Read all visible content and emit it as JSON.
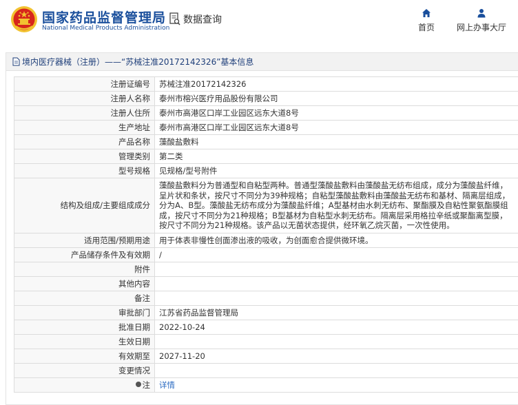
{
  "header": {
    "title_cn": "国家药品监督管理局",
    "title_en": "National Medical Products Administration",
    "query_label": "数据查询",
    "nav": [
      {
        "label": "首页",
        "icon": "home-icon"
      },
      {
        "label": "网上办事大厅",
        "icon": "user-icon"
      }
    ]
  },
  "colors": {
    "brand": "#1a4f9c",
    "emblem_red": "#d7261c",
    "emblem_gold": "#f2c230",
    "link": "#2b6bc2"
  },
  "breadcrumb": "境内医疗器械（注册）——“苏械注准20172142326”基本信息",
  "rows": [
    {
      "label": "注册证编号",
      "value": "苏械注准20172142326"
    },
    {
      "label": "注册人名称",
      "value": "泰州市榕兴医疗用品股份有限公司"
    },
    {
      "label": "注册人住所",
      "value": "泰州市高港区口岸工业园区远东大道8号"
    },
    {
      "label": "生产地址",
      "value": "泰州市高港区口岸工业园区远东大道8号"
    },
    {
      "label": "产品名称",
      "value": "藻酸盐敷料"
    },
    {
      "label": "管理类别",
      "value": "第二类"
    },
    {
      "label": "型号规格",
      "value": "见规格/型号附件"
    },
    {
      "label": "结构及组成/主要组成成分",
      "value": "藻酸盐敷料分为普通型和自粘型两种。普通型藻酸盐敷料由藻酸盐无纺布组成，成分为藻酸盐纤维，呈片状和条状，按尺寸不同分为39种规格；自粘型藻酸盐敷料由藻酸盐无纺布和基材、隔离层组成，分为A、B型。藻酸盐无纺布成分为藻酸盐纤维；A型基材由水刺无纺布、聚酯膜及自粘性聚氨酯膜组成，按尺寸不同分为21种规格；B型基材为自粘型水刺无纺布。隔离层采用格拉辛纸或聚酯离型膜，按尺寸不同分为21种规格。该产品以无菌状态提供，经环氧乙烷灭菌，一次性使用。"
    },
    {
      "label": "适用范围/预期用途",
      "value": "用于体表非慢性创面渗出液的吸收，为创面愈合提供微环境。"
    },
    {
      "label": "产品储存条件及有效期",
      "value": "/"
    },
    {
      "label": "附件",
      "value": ""
    },
    {
      "label": "其他内容",
      "value": ""
    },
    {
      "label": "备注",
      "value": ""
    },
    {
      "label": "审批部门",
      "value": "江苏省药品监督管理局"
    },
    {
      "label": "批准日期",
      "value": "2022-10-24"
    },
    {
      "label": "生效日期",
      "value": ""
    },
    {
      "label": "有效期至",
      "value": "2027-11-20"
    },
    {
      "label": "变更情况",
      "value": ""
    },
    {
      "label": "注",
      "value": "详情",
      "icon": "note-icon"
    }
  ]
}
